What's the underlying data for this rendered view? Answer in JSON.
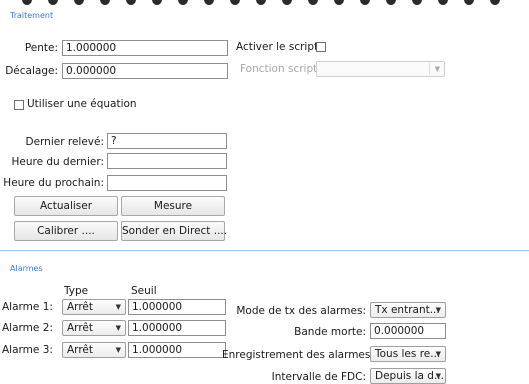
{
  "traitement": {
    "title": "Traitement",
    "pente_label": "Pente:",
    "pente_value": "1.000000",
    "decalage_label": "Décalage:",
    "decalage_value": "0.000000",
    "script_label": "Activer le script:",
    "fonction_label": "Fonction script:",
    "fonction_value": "",
    "equation_label": "Utiliser une équation",
    "dernier_releve_label": "Dernier relevé:",
    "dernier_releve_value": "?",
    "heure_dernier_label": "Heure du dernier:",
    "heure_dernier_value": "",
    "heure_prochain_label": "Heure du prochain:",
    "heure_prochain_value": "",
    "btn_actualiser": "Actualiser",
    "btn_mesure": "Mesure",
    "btn_calibrer": "Calibrer ....",
    "btn_sonder": "Sonder en Direct ...."
  },
  "alarmes": {
    "title": "Alarmes",
    "col_type": "Type",
    "col_seuil": "Seuil",
    "rows": [
      {
        "label": "Alarme 1:",
        "type": "Arrêt",
        "seuil": "1.000000"
      },
      {
        "label": "Alarme 2:",
        "type": "Arrêt",
        "seuil": "1.000000"
      },
      {
        "label": "Alarme 3:",
        "type": "Arrêt",
        "seuil": "1.000000"
      }
    ],
    "mode_label": "Mode de tx des alarmes:",
    "mode_value": "Tx entrant...",
    "bande_label": "Bande morte:",
    "bande_value": "0.000000",
    "enreg_label": "Enregistrement des alarmes:",
    "enreg_value": "Tous les re...",
    "intervalle_label": "Intervalle de FDC:",
    "intervalle_value": "Depuis la d..."
  },
  "icons": {
    "dropdown": "chevron-down-icon"
  }
}
